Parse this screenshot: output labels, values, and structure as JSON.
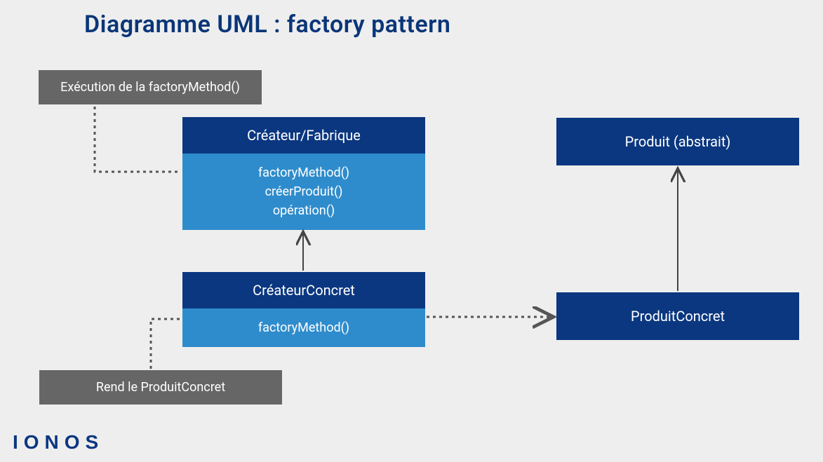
{
  "title": "Diagramme UML : factory pattern",
  "notes": {
    "note1": "Exécution de la factoryMethod()",
    "note2": "Rend le ProduitConcret"
  },
  "classes": {
    "creator": {
      "name": "Créateur/Fabrique",
      "methods": "factoryMethod()\ncréerProduit()\nopération()"
    },
    "concreteCreator": {
      "name": "CréateurConcret",
      "methods": "factoryMethod()"
    },
    "product": {
      "name": "Produit (abstrait)"
    },
    "concreteProduct": {
      "name": "ProduitConcret"
    }
  },
  "logo": "IONOS"
}
